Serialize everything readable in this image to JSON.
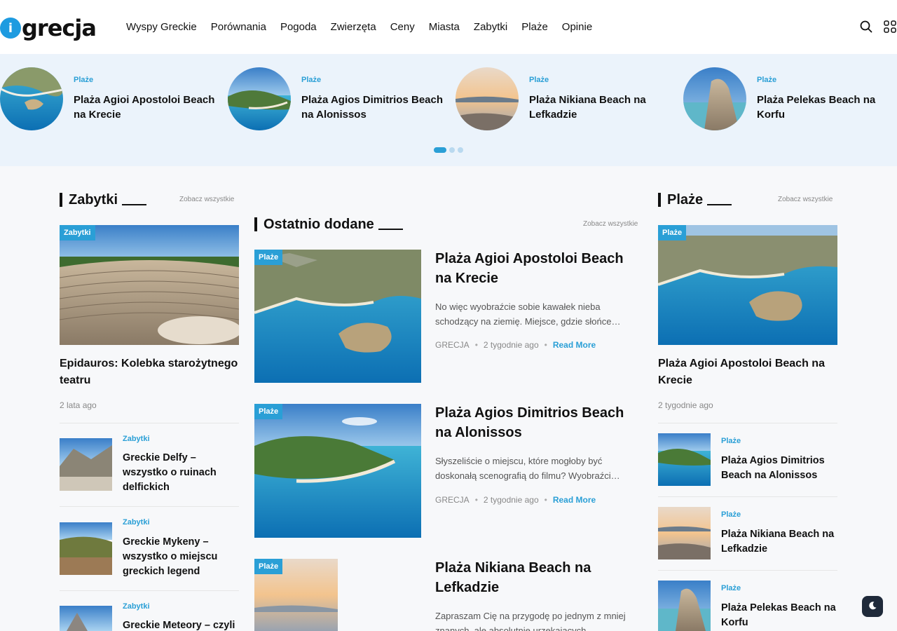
{
  "brand": {
    "logo_letter": "i",
    "logo_text": "grecja"
  },
  "nav": [
    "Wyspy Greckie",
    "Porównania",
    "Pogoda",
    "Zwierzęta",
    "Ceny",
    "Miasta",
    "Zabytki",
    "Plaże",
    "Opinie"
  ],
  "icons": {
    "search": "search-icon",
    "menu": "grid-menu-icon",
    "dark_mode": "moon-icon"
  },
  "featured": [
    {
      "category": "Plaże",
      "title": "Plaża Agioi Apostoloi Beach na Krecie"
    },
    {
      "category": "Plaże",
      "title": "Plaża Agios Dimitrios Beach na Alonissos"
    },
    {
      "category": "Plaże",
      "title": "Plaża Nikiana Beach na Lefkadzie"
    },
    {
      "category": "Plaże",
      "title": "Plaża Pelekas Beach na Korfu"
    }
  ],
  "zabytki": {
    "heading": "Zabytki",
    "see_all": "Zobacz wszystkie",
    "main": {
      "badge": "Zabytki",
      "title": "Epidauros: Kolebka starożytnego teatru",
      "date": "2 lata ago"
    },
    "items": [
      {
        "category": "Zabytki",
        "title": "Greckie Delfy – wszystko o ruinach delfickich"
      },
      {
        "category": "Zabytki",
        "title": "Greckie Mykeny – wszystko o miejscu greckich legend"
      },
      {
        "category": "Zabytki",
        "title": "Greckie Meteory – czyli"
      }
    ]
  },
  "ostatnio": {
    "heading": "Ostatnio dodane",
    "see_all": "Zobacz wszystkie",
    "posts": [
      {
        "badge": "Plaże",
        "title": "Plaża Agioi Apostoloi Beach na Krecie",
        "excerpt": "No więc wyobraźcie sobie kawałek nieba schodzący na ziemię. Miejsce, gdzie słońce…",
        "author": "GRECJA",
        "date": "2 tygodnie ago",
        "read_more": "Read More"
      },
      {
        "badge": "Plaże",
        "title": "Plaża Agios Dimitrios Beach na Alonissos",
        "excerpt": "Słyszeliście o miejscu, które mogłoby być doskonałą scenografią do filmu? Wyobraźci…",
        "author": "GRECJA",
        "date": "2 tygodnie ago",
        "read_more": "Read More"
      },
      {
        "badge": "Plaże",
        "title": "Plaża Nikiana Beach na Lefkadzie",
        "excerpt": "Zapraszam Cię na przygodę po jednym z mniej znanych, ale absolutnie urzekających…"
      }
    ]
  },
  "plaze": {
    "heading": "Plaże",
    "see_all": "Zobacz wszystkie",
    "main": {
      "badge": "Plaże",
      "title": "Plaża Agioi Apostoloi Beach na Krecie",
      "date": "2 tygodnie ago"
    },
    "items": [
      {
        "category": "Plaże",
        "title": "Plaża Agios Dimitrios Beach na Alonissos"
      },
      {
        "category": "Plaże",
        "title": "Plaża Nikiana Beach na Lefkadzie"
      },
      {
        "category": "Plaże",
        "title": "Plaża Pelekas Beach na Korfu"
      }
    ]
  },
  "colors": {
    "accent": "#2a9fd6",
    "strip_bg": "#ebf3fb",
    "page_bg": "#f7f8fa",
    "dark_button": "#1f2a3a"
  }
}
